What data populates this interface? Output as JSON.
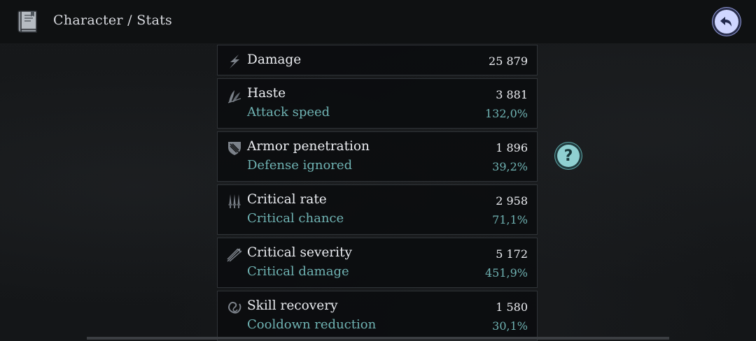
{
  "header": {
    "title": "Character / Stats",
    "icon": "book-icon",
    "back_icon": "back-arrow-icon"
  },
  "colors": {
    "accent_teal": "#6fb3b3",
    "back_button": "#cfd6ff",
    "help_button": "#8fd0d1"
  },
  "help": {
    "label": "?"
  },
  "stats": [
    {
      "icon": "lightning-icon",
      "name": "Damage",
      "value": "25 879"
    },
    {
      "icon": "feather-icon",
      "name": "Haste",
      "value": "3 881",
      "sub": "Attack speed",
      "subvalue": "132,0%"
    },
    {
      "icon": "shield-icon",
      "name": "Armor penetration",
      "value": "1 896",
      "sub": "Defense ignored",
      "subvalue": "39,2%"
    },
    {
      "icon": "daggers-icon",
      "name": "Critical rate",
      "value": "2 958",
      "sub": "Critical chance",
      "subvalue": "71,1%"
    },
    {
      "icon": "arrows-icon",
      "name": "Critical severity",
      "value": "5 172",
      "sub": "Critical damage",
      "subvalue": "451,9%"
    },
    {
      "icon": "spiral-icon",
      "name": "Skill recovery",
      "value": "1 580",
      "sub": "Cooldown reduction",
      "subvalue": "30,1%"
    }
  ]
}
